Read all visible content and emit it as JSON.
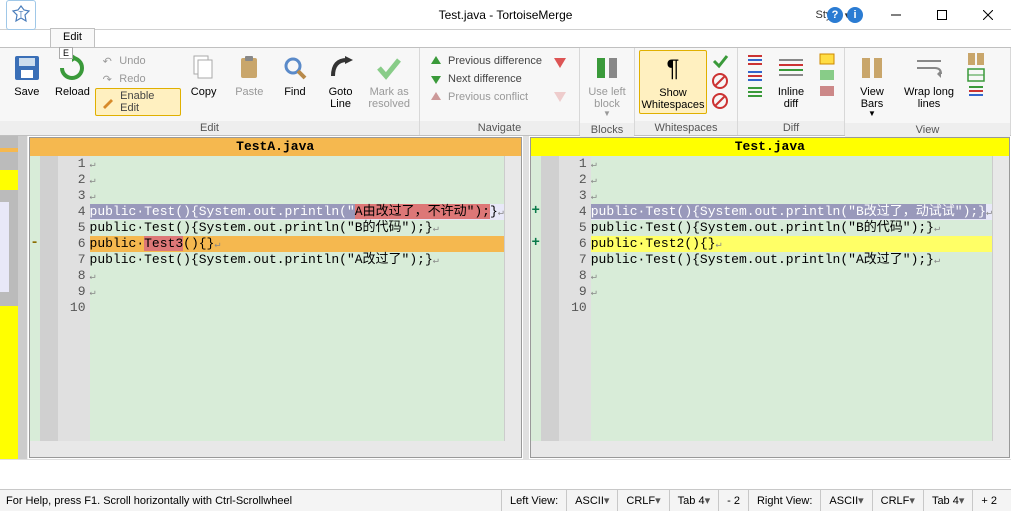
{
  "title": "Test.java - TortoiseMerge",
  "style_label": "Style",
  "ribbon_tab": "Edit",
  "ribbon_tab_hint": "E",
  "ribbon": {
    "save": "Save",
    "reload": "Reload",
    "undo": "Undo",
    "redo": "Redo",
    "enable_edit": "Enable Edit",
    "copy": "Copy",
    "paste": "Paste",
    "find": "Find",
    "goto_line": "Goto Line",
    "mark_resolved": "Mark as resolved",
    "prev_diff": "Previous difference",
    "next_diff": "Next difference",
    "prev_conflict": "Previous conflict",
    "use_left_block": "Use left block",
    "show_whitespaces": "Show Whitespaces",
    "inline_diff": "Inline diff",
    "view_bars": "View Bars",
    "wrap_long_lines": "Wrap long lines"
  },
  "ribbon_groups": {
    "edit": "Edit",
    "navigate": "Navigate",
    "blocks": "Blocks",
    "whitespaces": "Whitespaces",
    "diff": "Diff",
    "view": "View"
  },
  "left_pane": {
    "title": "TestA.java",
    "lines": [
      {
        "n": 1,
        "text": ""
      },
      {
        "n": 2,
        "text": ""
      },
      {
        "n": 3,
        "text": ""
      },
      {
        "n": 4,
        "text": "public·Test(){System.out.println(\"A由改过了，不许动\");}",
        "diff": true,
        "inline_del": [
          34,
          46
        ],
        "sel": [
          0,
          34
        ]
      },
      {
        "n": 5,
        "text": "public·Test(){System.out.println(\"B的代码\");}"
      },
      {
        "n": 6,
        "text": "public·Test3(){}",
        "edit": true,
        "inline_del": [
          7,
          12
        ],
        "sig": "-"
      },
      {
        "n": 7,
        "text": "public·Test(){System.out.println(\"A改过了\");}"
      },
      {
        "n": 8,
        "text": ""
      },
      {
        "n": 9,
        "text": ""
      },
      {
        "n": 10,
        "text": ""
      }
    ]
  },
  "right_pane": {
    "title": "Test.java",
    "lines": [
      {
        "n": 1,
        "text": ""
      },
      {
        "n": 2,
        "text": ""
      },
      {
        "n": 3,
        "text": ""
      },
      {
        "n": 4,
        "text": "public·Test(){System.out.println(\"B改过了，动试试\");}",
        "diff": true,
        "sel": [
          0,
          49
        ],
        "sig": "+"
      },
      {
        "n": 5,
        "text": "public·Test(){System.out.println(\"B的代码\");}"
      },
      {
        "n": 6,
        "text": "public·Test2(){}",
        "edit": true,
        "sig": "+"
      },
      {
        "n": 7,
        "text": "public·Test(){System.out.println(\"A改过了\");}"
      },
      {
        "n": 8,
        "text": ""
      },
      {
        "n": 9,
        "text": ""
      },
      {
        "n": 10,
        "text": ""
      }
    ]
  },
  "statusbar": {
    "help": "For Help, press F1. Scroll horizontally with Ctrl-Scrollwheel",
    "left_view": "Left View:",
    "right_view": "Right View:",
    "ascii": "ASCII",
    "crlf": "CRLF",
    "tab": "Tab 4",
    "left_delta": "- 2",
    "right_delta": "+ 2"
  }
}
